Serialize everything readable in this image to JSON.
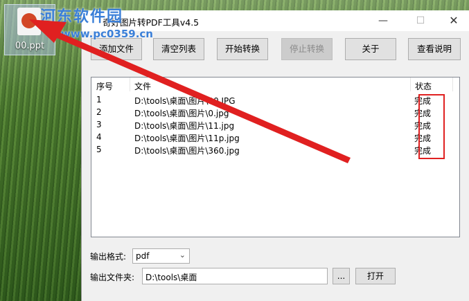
{
  "desktop": {
    "icon_label": "00.ppt",
    "watermark_text": "河东软件园",
    "watermark_url": "www.pc0359.cn"
  },
  "window": {
    "title": "奇好图片转PDF工具v4.5",
    "controls": {
      "minimize": "—",
      "maximize": "☐",
      "close": "✕"
    }
  },
  "toolbar": {
    "add_file": "添加文件",
    "clear_list": "清空列表",
    "start_convert": "开始转换",
    "stop_convert": "停止转换",
    "about": "关于",
    "help": "查看说明"
  },
  "list": {
    "columns": {
      "index": "序号",
      "file": "文件",
      "status": "状态"
    },
    "rows": [
      {
        "index": "1",
        "file": "D:\\tools\\桌面\\图片\\00.JPG",
        "status": "完成"
      },
      {
        "index": "2",
        "file": "D:\\tools\\桌面\\图片\\0.jpg",
        "status": "完成"
      },
      {
        "index": "3",
        "file": "D:\\tools\\桌面\\图片\\11.jpg",
        "status": "完成"
      },
      {
        "index": "4",
        "file": "D:\\tools\\桌面\\图片\\11p.jpg",
        "status": "完成"
      },
      {
        "index": "5",
        "file": "D:\\tools\\桌面\\图片\\360.jpg",
        "status": "完成"
      }
    ]
  },
  "output": {
    "format_label": "输出格式:",
    "format_value": "pdf",
    "folder_label": "输出文件夹:",
    "folder_value": "D:\\tools\\桌面",
    "browse_label": "...",
    "open_label": "打开"
  },
  "colors": {
    "annotation": "#e02020",
    "watermark": "#3a7fd8"
  }
}
